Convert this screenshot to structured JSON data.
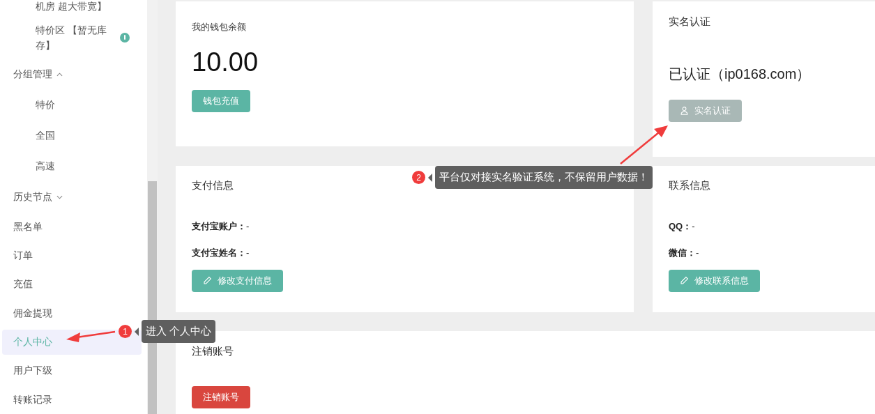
{
  "sidebar": {
    "items": [
      {
        "label": "机房 超大带宽】",
        "kind": "sub",
        "selected": false
      },
      {
        "label": "特价区 【暂无库存】",
        "kind": "sub",
        "selected": false,
        "info": true
      },
      {
        "label": "分组管理",
        "kind": "group",
        "expanded": true,
        "children": [
          {
            "label": "特价",
            "selected": false
          },
          {
            "label": "全国",
            "selected": false
          },
          {
            "label": "高速",
            "selected": false
          }
        ]
      },
      {
        "label": "历史节点",
        "kind": "group",
        "expanded": false
      },
      {
        "label": "黑名单",
        "kind": "item",
        "selected": false
      },
      {
        "label": "订单",
        "kind": "item",
        "selected": false
      },
      {
        "label": "充值",
        "kind": "item",
        "selected": false
      },
      {
        "label": "佣金提现",
        "kind": "item",
        "selected": false
      },
      {
        "label": "个人中心",
        "kind": "item",
        "selected": true
      },
      {
        "label": "用户下级",
        "kind": "item",
        "selected": false
      },
      {
        "label": "转账记录",
        "kind": "item",
        "selected": false
      }
    ]
  },
  "wallet": {
    "title": "我的钱包余额",
    "balance": "10.00",
    "button": "钱包充值"
  },
  "verification": {
    "title": "实名认证",
    "status": "已认证（ip0168.com）",
    "button": "实名认证",
    "disabled": true
  },
  "payment": {
    "title": "支付信息",
    "fields": [
      "**支付宝账户：**-",
      "**支付宝姓名：**-"
    ],
    "button": "修改支付信息"
  },
  "contact": {
    "title": "联系信息",
    "fields": [
      "**QQ：**-",
      "**微信：**-"
    ],
    "button": "修改联系信息"
  },
  "cancel": {
    "title": "注销账号",
    "button": "注销账号"
  },
  "annotations": [
    {
      "number": "1",
      "text": "进入 个人中心"
    },
    {
      "number": "2",
      "text": "平台仅对接实名验证系统，不保留用户数据！"
    }
  ]
}
